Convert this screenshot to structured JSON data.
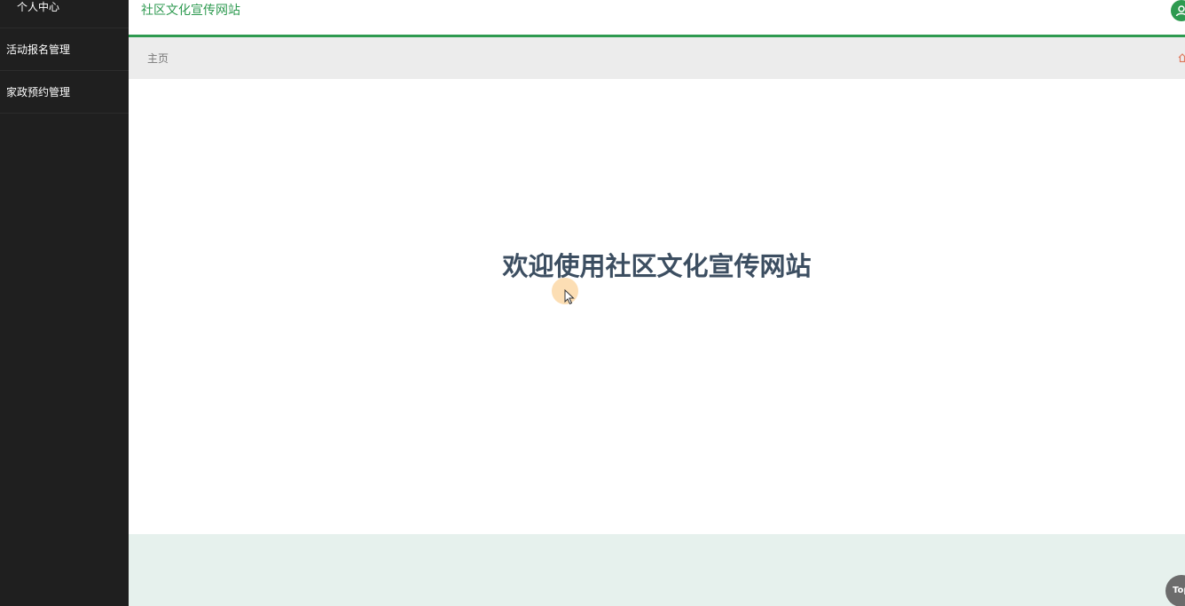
{
  "sidebar": {
    "items": [
      {
        "label": "个人中心"
      },
      {
        "label": "活动报名管理"
      },
      {
        "label": "家政预约管理"
      }
    ]
  },
  "header": {
    "title": "社区文化宣传网站",
    "avatar_icon": "user-icon"
  },
  "breadcrumb": {
    "home_label": "主页",
    "home_icon": "home-icon"
  },
  "main": {
    "welcome_text": "欢迎使用社区文化宣传网站"
  },
  "footer": {
    "top_label": "Top"
  },
  "colors": {
    "accent": "#2e9a50",
    "sidebar_bg": "#1f1f1f",
    "breadcrumb_bg": "#ececec",
    "footer_bg": "#e6f1ed",
    "welcome_text": "#3c4e61"
  }
}
